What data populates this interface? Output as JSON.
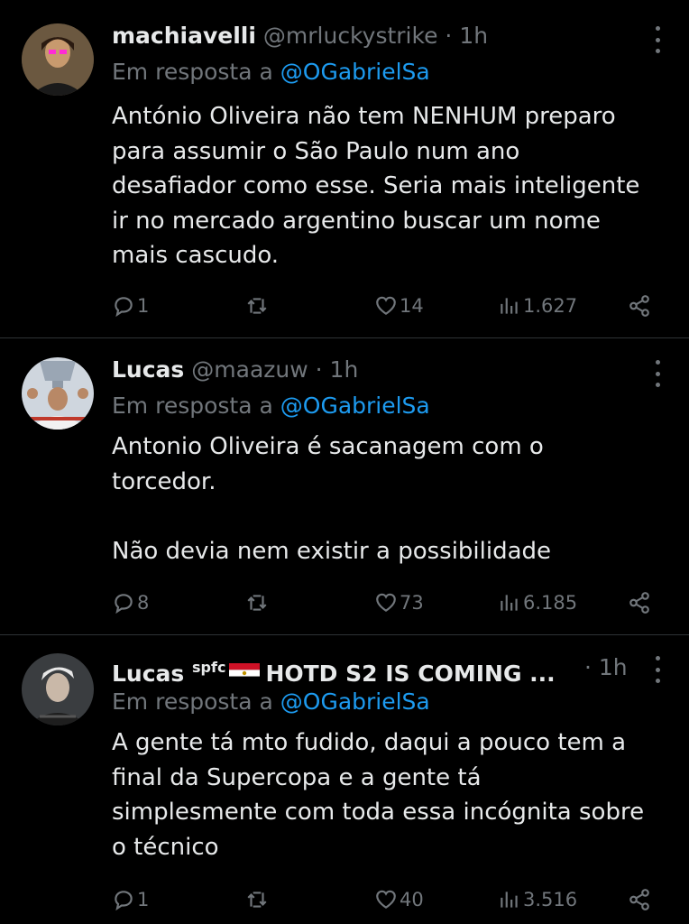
{
  "tweets": [
    {
      "name": "machiavelli",
      "handle": "@mrluckystrike",
      "dot": "·",
      "time": "1h",
      "reply_prefix": "Em resposta a",
      "reply_to": "@OGabrielSa",
      "text": "António Oliveira não tem NENHUM preparo\npara assumir o São Paulo num ano\ndesafiador como esse. Seria mais inteligente\nir no mercado argentino buscar um nome\nmais cascudo.",
      "replies": "1",
      "retweets": "",
      "likes": "14",
      "views": "1.627"
    },
    {
      "name": "Lucas",
      "handle": "@maazuw",
      "dot": "·",
      "time": "1h",
      "reply_prefix": "Em resposta a",
      "reply_to": "@OGabrielSa",
      "text": "Antonio Oliveira é sacanagem com o\ntorcedor.\n\nNão devia nem existir a possibilidade",
      "replies": "8",
      "retweets": "",
      "likes": "73",
      "views": "6.185"
    },
    {
      "name": "Lucas",
      "name_sup": "spfc",
      "name_suffix": "HOTD S2 IS COMING ...",
      "dot": "·",
      "time": "1h",
      "reply_prefix": "Em resposta a",
      "reply_to": "@OGabrielSa",
      "text": "A gente tá mto fudido, daqui a pouco tem a\nfinal da Supercopa e a gente tá\nsimplesmente com toda essa incógnita sobre\no técnico",
      "replies": "1",
      "retweets": "",
      "likes": "40",
      "views": "3.516"
    }
  ],
  "colors": {
    "background": "#000000",
    "text": "#e7e9ea",
    "secondary": "#71767b",
    "mention": "#1d9bf0",
    "divider": "#2f3336"
  },
  "icons": [
    "reply-icon",
    "retweet-icon",
    "like-icon",
    "views-icon",
    "share-icon",
    "more-icon",
    "egypt-flag-icon"
  ]
}
